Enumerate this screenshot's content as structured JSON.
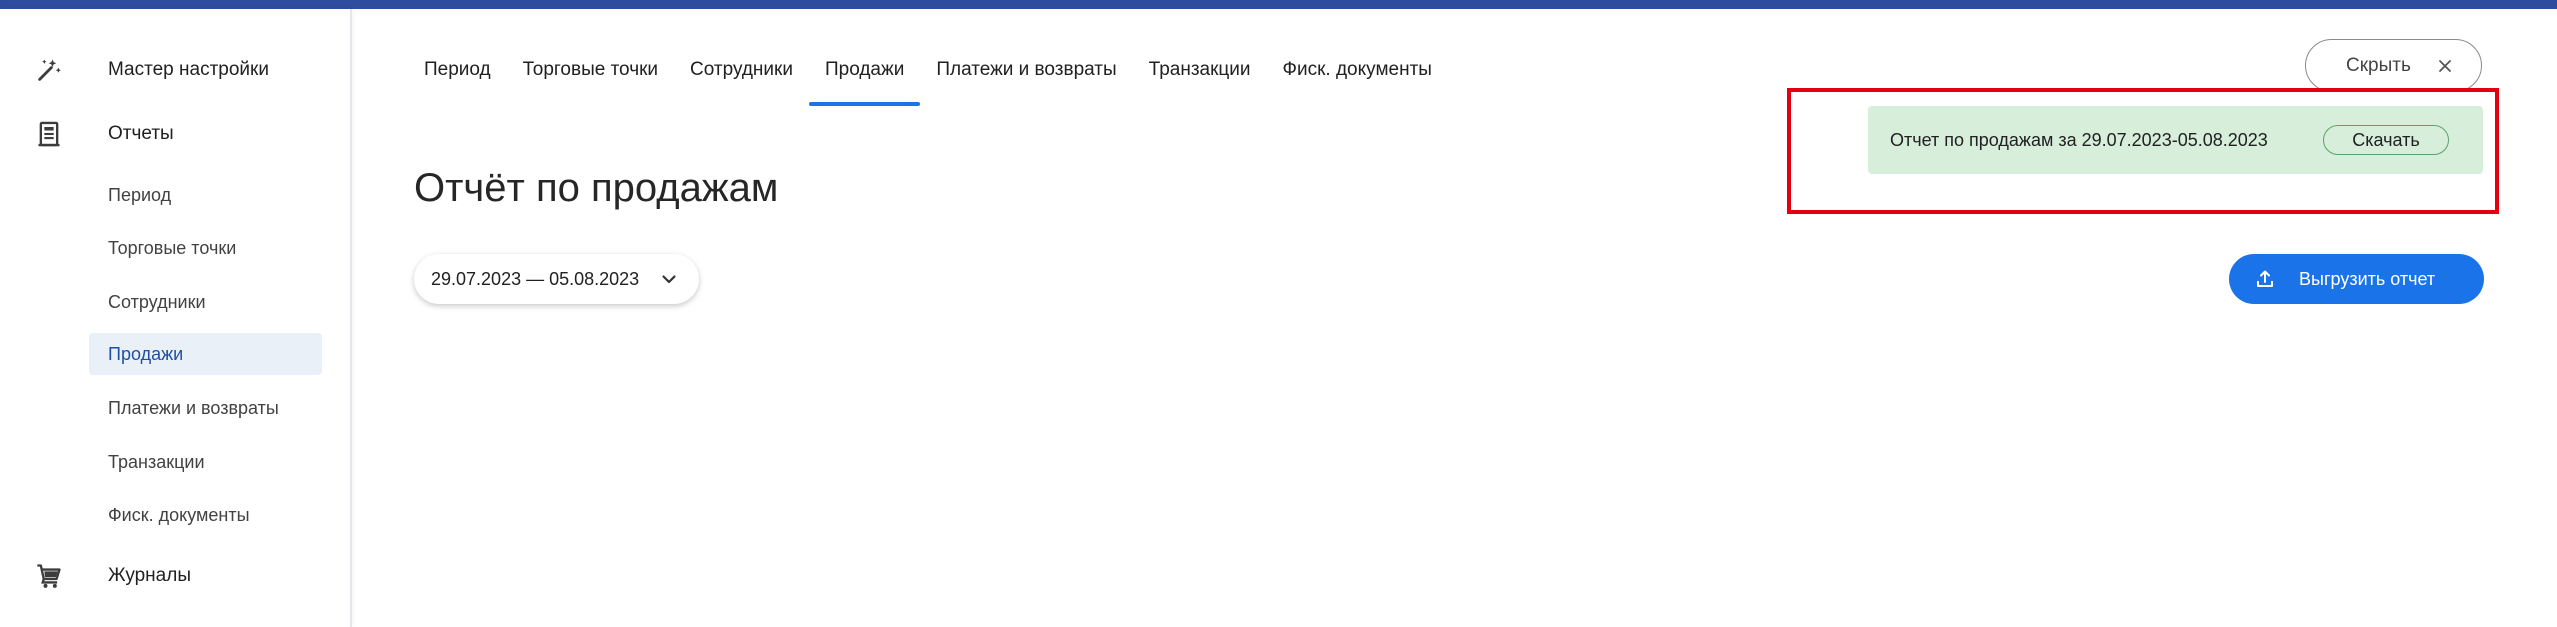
{
  "sidebar": {
    "sections": [
      {
        "label": "Мастер настройки",
        "icon": "magic-wand-icon"
      },
      {
        "label": "Отчеты",
        "icon": "receipt-icon"
      },
      {
        "label": "Журналы",
        "icon": "cart-icon"
      }
    ],
    "items": [
      {
        "label": "Период"
      },
      {
        "label": "Торговые точки"
      },
      {
        "label": "Сотрудники"
      },
      {
        "label": "Продажи",
        "active": true
      },
      {
        "label": "Платежи и возвраты"
      },
      {
        "label": "Транзакции"
      },
      {
        "label": "Фиск. документы"
      }
    ]
  },
  "tabs": [
    {
      "label": "Период"
    },
    {
      "label": "Торговые точки"
    },
    {
      "label": "Сотрудники"
    },
    {
      "label": "Продажи",
      "active": true
    },
    {
      "label": "Платежи и возвраты"
    },
    {
      "label": "Транзакции"
    },
    {
      "label": "Фиск. документы"
    }
  ],
  "main": {
    "title": "Отчёт по продажам",
    "date_range": "29.07.2023 — 05.08.2023",
    "hide_label": "Скрыть",
    "notice_text": "Отчет по продажам за 29.07.2023-05.08.2023",
    "download_label": "Скачать",
    "export_label": "Выгрузить отчет"
  },
  "colors": {
    "accent": "#1a73e8",
    "topbar": "#2f4d9e",
    "notice_bg": "#d7eedb",
    "highlight": "#e3000f"
  }
}
